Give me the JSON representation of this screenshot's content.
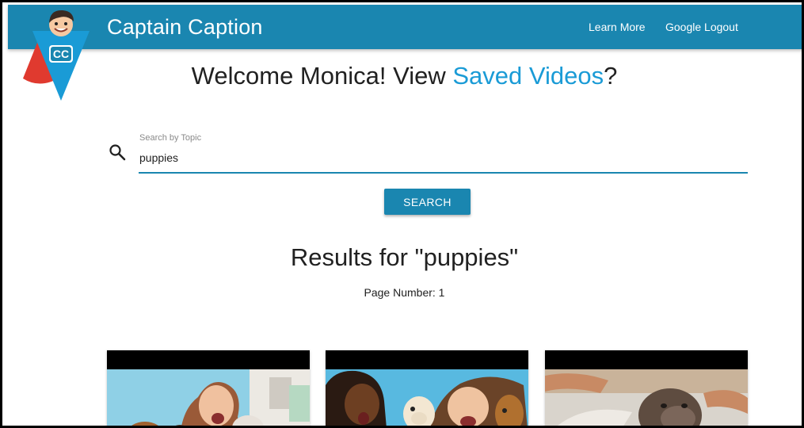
{
  "header": {
    "brand": "Captain Caption",
    "logo_badge": "CC",
    "nav": {
      "learn_more": "Learn More",
      "logout": "Google Logout"
    }
  },
  "welcome": {
    "prefix": "Welcome Monica! View ",
    "link": "Saved Videos",
    "suffix": "?"
  },
  "search": {
    "label": "Search by Topic",
    "value": "puppies",
    "button": "SEARCH"
  },
  "results": {
    "title": "Results for \"puppies\"",
    "page_number": "Page Number: 1"
  },
  "colors": {
    "primary": "#1a86b0",
    "link": "#1a9bd6",
    "text": "#212121",
    "frame": "#000000"
  },
  "icons": [
    "search-icon",
    "captain-caption-logo"
  ],
  "videos": [
    {
      "thumbnail": "video-thumbnail-1"
    },
    {
      "thumbnail": "video-thumbnail-2"
    },
    {
      "thumbnail": "video-thumbnail-3"
    }
  ]
}
